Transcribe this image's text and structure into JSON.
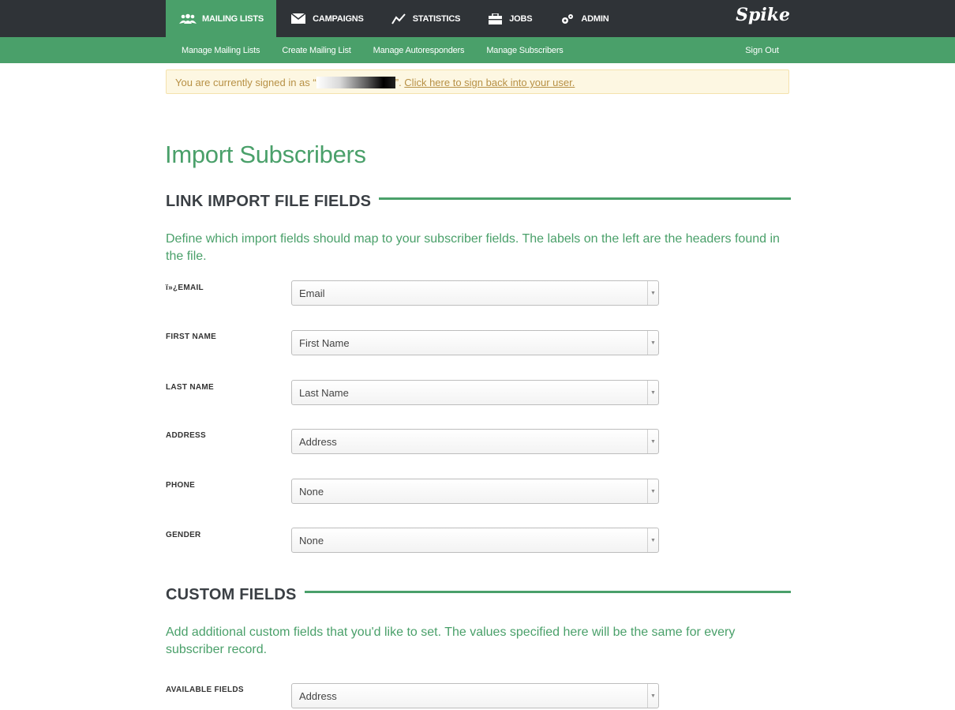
{
  "nav": {
    "items": [
      {
        "label": "MAILING LISTS",
        "icon": "users-icon",
        "active": true
      },
      {
        "label": "CAMPAIGNS",
        "icon": "envelope-icon",
        "active": false
      },
      {
        "label": "STATISTICS",
        "icon": "line-chart-icon",
        "active": false
      },
      {
        "label": "JOBS",
        "icon": "briefcase-icon",
        "active": false
      },
      {
        "label": "ADMIN",
        "icon": "gears-icon",
        "active": false
      }
    ],
    "logo": "Spike"
  },
  "subnav": {
    "items": [
      "Manage Mailing Lists",
      "Create Mailing List",
      "Manage Autoresponders",
      "Manage Subscribers"
    ],
    "signout": "Sign Out"
  },
  "alert": {
    "prefix": "You are currently signed in as “",
    "suffix": "”. ",
    "link": "Click here to sign back into your user."
  },
  "page": {
    "title": "Import Subscribers",
    "section1": {
      "heading": "LINK IMPORT FILE FIELDS",
      "description": "Define which import fields should map to your subscriber fields. The labels on the left are the headers found in the file.",
      "fields": [
        {
          "label": "ï»¿EMAIL",
          "value": "Email"
        },
        {
          "label": "FIRST NAME",
          "value": "First Name"
        },
        {
          "label": "LAST NAME",
          "value": "Last Name"
        },
        {
          "label": "ADDRESS",
          "value": "Address"
        },
        {
          "label": "PHONE",
          "value": "None"
        },
        {
          "label": "GENDER",
          "value": "None"
        }
      ]
    },
    "section2": {
      "heading": "CUSTOM FIELDS",
      "description": "Add additional custom fields that you'd like to set. The values specified here will be the same for every subscriber record.",
      "available_label": "AVAILABLE FIELDS",
      "available_value": "Address"
    }
  },
  "colors": {
    "accent": "#4aa06a",
    "topbar": "#2f3337",
    "alert_bg": "#fdf7e2",
    "alert_text": "#b79045"
  }
}
